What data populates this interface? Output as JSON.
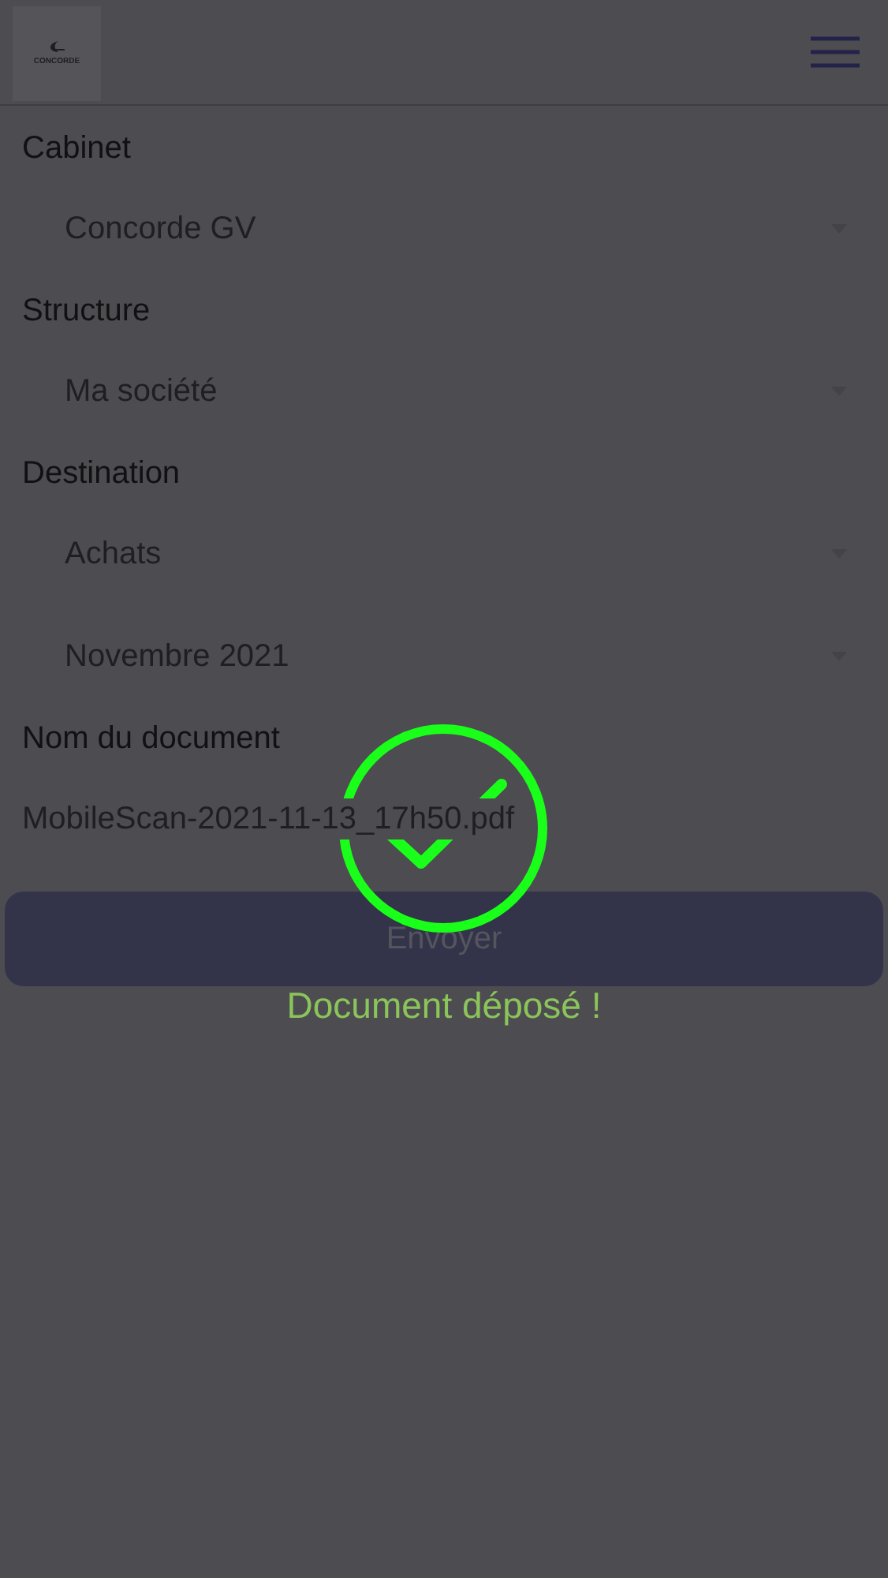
{
  "header": {
    "logo_text": "CONCORDE"
  },
  "fields": [
    {
      "kind": "select",
      "label": "Cabinet",
      "value": "Concorde GV"
    },
    {
      "kind": "select",
      "label": "Structure",
      "value": "Ma société"
    },
    {
      "kind": "select",
      "label": "Destination",
      "value": "Achats"
    },
    {
      "kind": "select",
      "value": "Novembre 2021"
    },
    {
      "kind": "text",
      "label": "Nom du document",
      "value": "MobileScan-2021-11-13_17h50.pdf"
    }
  ],
  "submit_button": "Envoyer",
  "toast": {
    "message": "Document déposé !"
  }
}
